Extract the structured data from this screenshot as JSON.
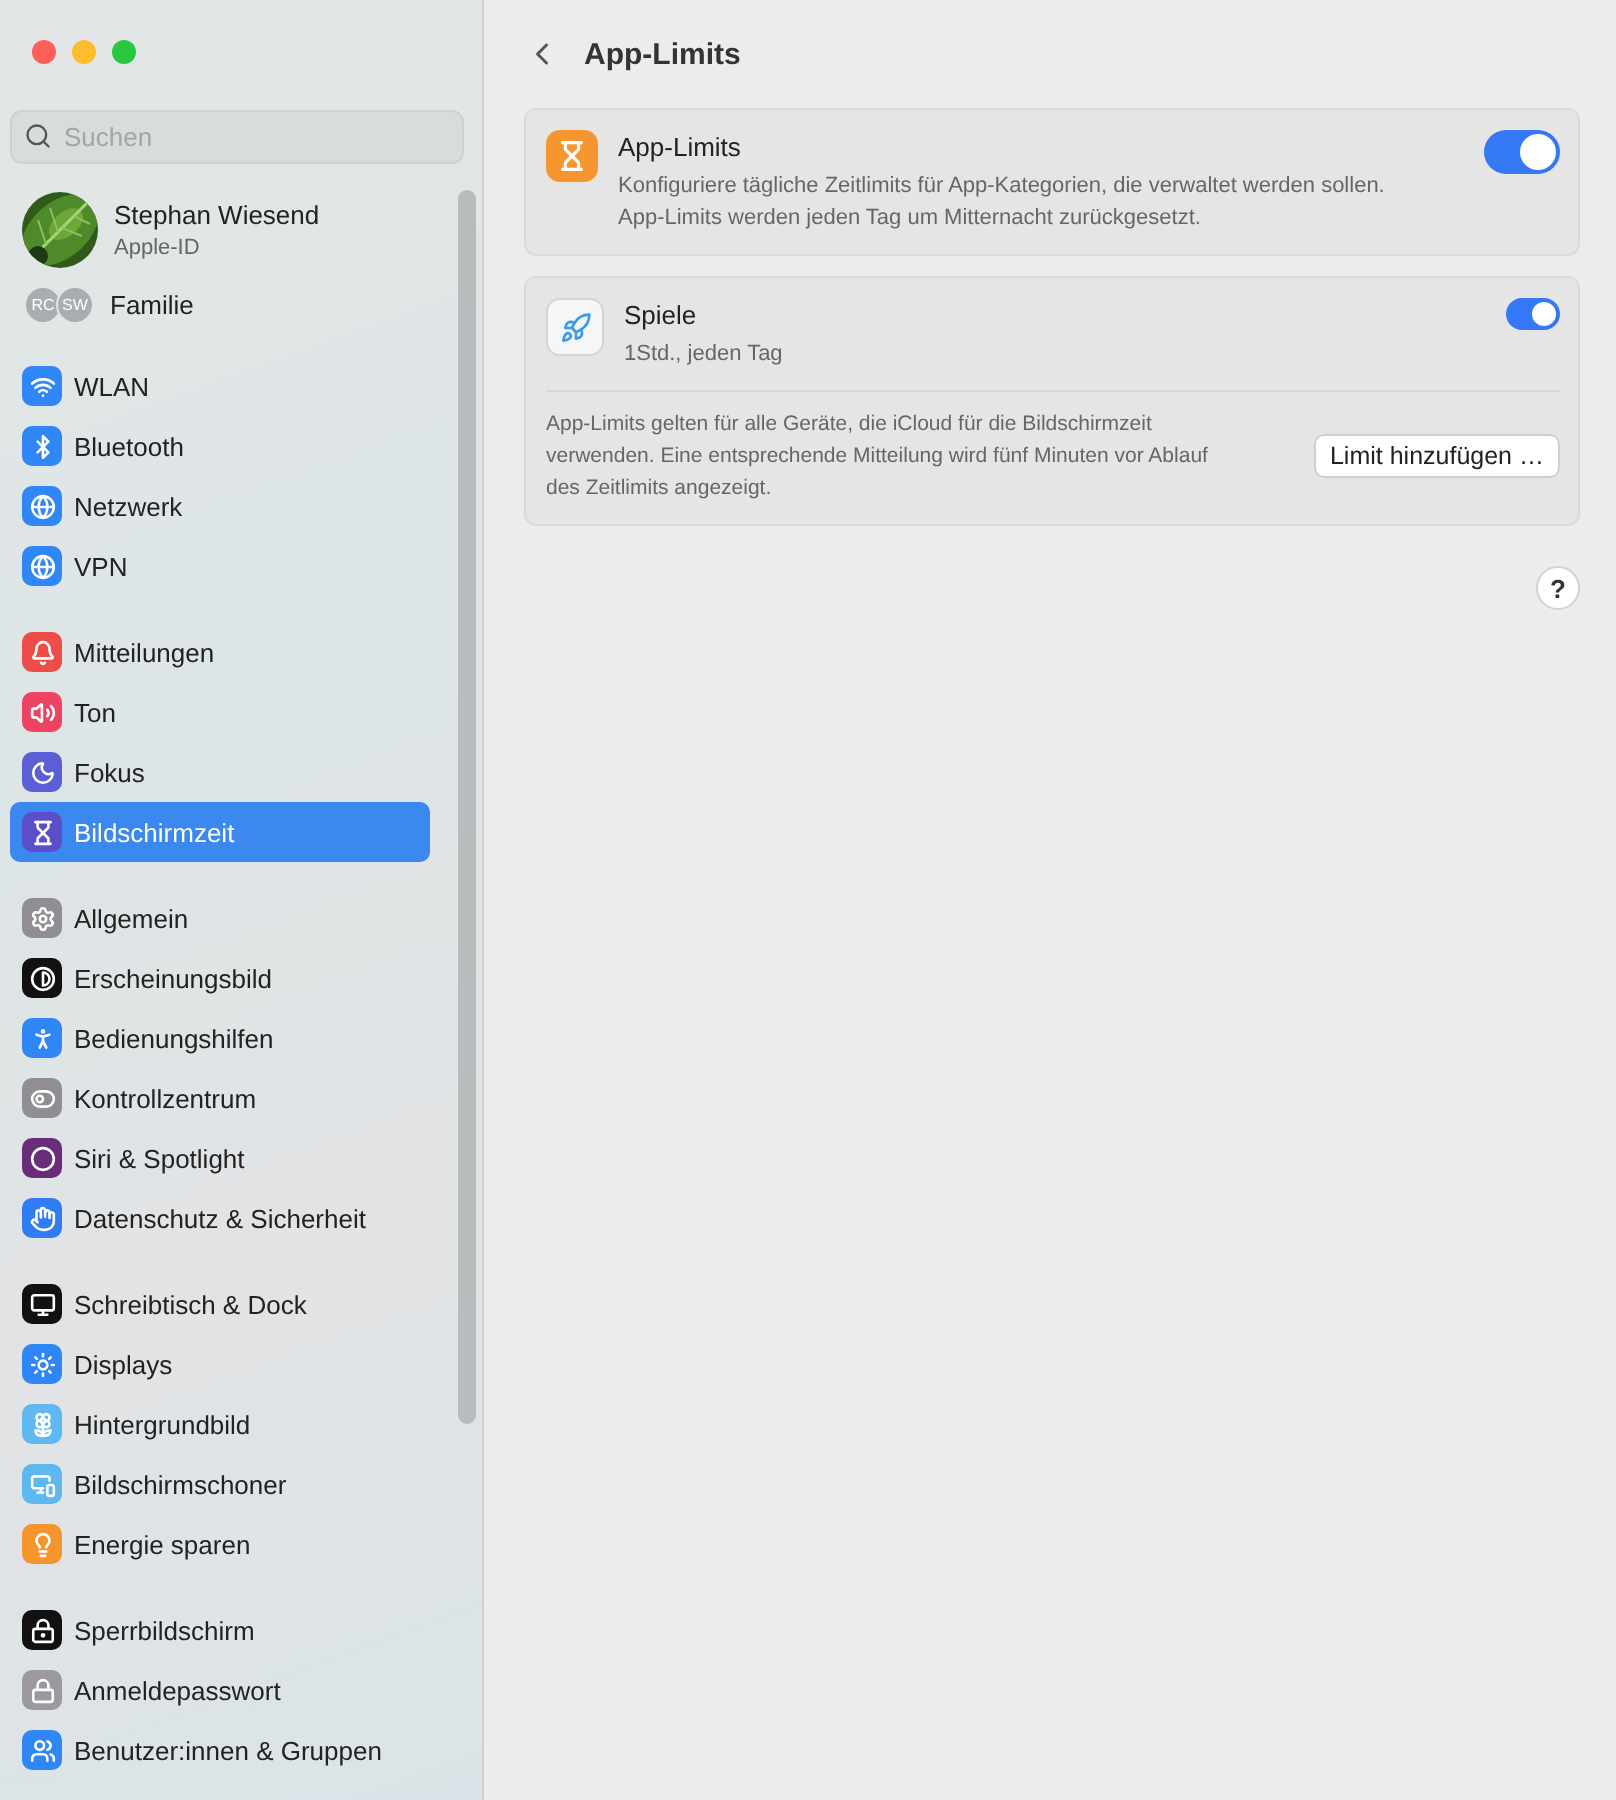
{
  "sidebar": {
    "search": {
      "placeholder": "Suchen"
    },
    "account": {
      "name": "Stephan Wiesend",
      "subtitle": "Apple-ID"
    },
    "family": {
      "label": "Familie",
      "members": [
        "RC",
        "SW"
      ]
    },
    "groups": [
      {
        "items": [
          {
            "label": "WLAN",
            "kind": "wifi",
            "selected": false
          },
          {
            "label": "Bluetooth",
            "kind": "bluetooth",
            "selected": false
          },
          {
            "label": "Netzwerk",
            "kind": "globe",
            "selected": false
          },
          {
            "label": "VPN",
            "kind": "vpn",
            "selected": false
          }
        ]
      },
      {
        "items": [
          {
            "label": "Mitteilungen",
            "kind": "bell",
            "selected": false
          },
          {
            "label": "Ton",
            "kind": "sound",
            "selected": false
          },
          {
            "label": "Fokus",
            "kind": "moon",
            "selected": false
          },
          {
            "label": "Bildschirmzeit",
            "kind": "hourglass",
            "selected": true
          }
        ]
      },
      {
        "items": [
          {
            "label": "Allgemein",
            "kind": "gear",
            "selected": false
          },
          {
            "label": "Erscheinungsbild",
            "kind": "appearance",
            "selected": false
          },
          {
            "label": "Bedienungshilfen",
            "kind": "accessibility",
            "selected": false
          },
          {
            "label": "Kontrollzentrum",
            "kind": "toggles",
            "selected": false
          },
          {
            "label": "Siri & Spotlight",
            "kind": "siri",
            "selected": false
          },
          {
            "label": "Datenschutz & Sicherheit",
            "kind": "hand",
            "selected": false
          }
        ]
      },
      {
        "items": [
          {
            "label": "Schreibtisch & Dock",
            "kind": "dock",
            "selected": false
          },
          {
            "label": "Displays",
            "kind": "sun",
            "selected": false
          },
          {
            "label": "Hintergrundbild",
            "kind": "flower",
            "selected": false
          },
          {
            "label": "Bildschirmschoner",
            "kind": "screensaver",
            "selected": false
          },
          {
            "label": "Energie sparen",
            "kind": "bulb",
            "selected": false
          }
        ]
      },
      {
        "items": [
          {
            "label": "Sperrbildschirm",
            "kind": "lockscreen",
            "selected": false
          },
          {
            "label": "Anmeldepasswort",
            "kind": "lock",
            "selected": false
          },
          {
            "label": "Benutzer:innen & Gruppen",
            "kind": "users",
            "selected": false
          }
        ]
      }
    ]
  },
  "main": {
    "title": "App-Limits",
    "master": {
      "title": "App-Limits",
      "description_lines": [
        "Konfiguriere tägliche Zeitlimits für App-Kategorien, die verwaltet werden sollen.",
        "App-Limits werden jeden Tag um Mitternacht zurückgesetzt."
      ],
      "on": true
    },
    "category": {
      "title": "Spiele",
      "subtitle": "1Std., jeden Tag",
      "on": true
    },
    "note": "App-Limits gelten für alle Geräte, die iCloud für die Bildschirmzeit verwenden. Eine entsprechende Mitteilung wird fünf Minuten vor Ablauf des Zeitlimits angezeigt.",
    "add_button": "Limit hinzufügen …",
    "help": "?"
  }
}
